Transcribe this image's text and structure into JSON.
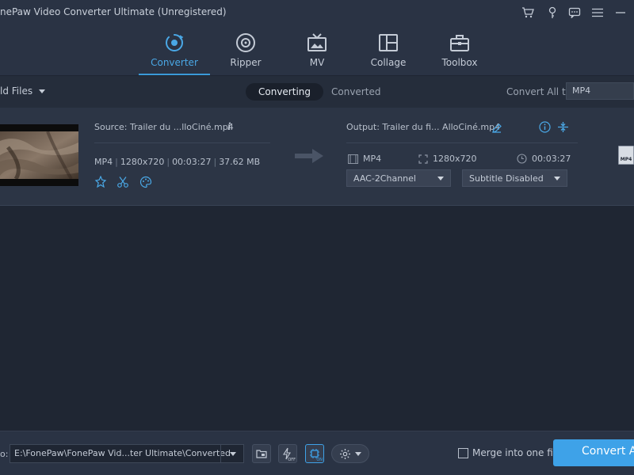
{
  "app": {
    "title": "nePaw Video Converter Ultimate (Unregistered)"
  },
  "titlebar_icons": [
    "cart-icon",
    "key-icon",
    "chat-icon",
    "menu-icon",
    "minimize-icon"
  ],
  "nav": {
    "tabs": [
      {
        "label": "Converter",
        "icon": "converter-icon",
        "active": true
      },
      {
        "label": "Ripper",
        "icon": "ripper-icon",
        "active": false
      },
      {
        "label": "MV",
        "icon": "mv-icon",
        "active": false
      },
      {
        "label": "Collage",
        "icon": "collage-icon",
        "active": false
      },
      {
        "label": "Toolbox",
        "icon": "toolbox-icon",
        "active": false
      }
    ]
  },
  "toolbar": {
    "add_files": "ld Files",
    "segments": [
      "Converting",
      "Converted"
    ],
    "active_segment": "Converting",
    "convert_all_label": "Convert All to:",
    "convert_all_value": "MP4"
  },
  "file": {
    "source_name": "Source: Trailer du ...lloCiné.mp4",
    "info_label": "i",
    "src_meta": {
      "format": "MP4",
      "resolution": "1280x720",
      "duration": "00:03:27",
      "size": "37.62 MB"
    },
    "output_name": "Output: Trailer du fi... AlloCiné.mp4",
    "out_meta": {
      "format": "MP4",
      "resolution": "1280x720",
      "duration": "00:03:27"
    },
    "audio_track": "AAC-2Channel",
    "subtitle": "Subtitle Disabled",
    "format_badge": "MP4"
  },
  "bottom": {
    "save_label": "o:",
    "save_path": "E:\\FonePaw\\FonePaw Vid...ter Ultimate\\Converted",
    "hw_off_label": "OFF",
    "gpu_on_label": "ON",
    "merge_label": "Merge into one file",
    "merge_checked": false,
    "convert_button": "Convert All"
  },
  "colors": {
    "accent": "#3ea2e8",
    "active_tab": "#4aa8e6",
    "background": "#1f2633",
    "panel": "#2a3344"
  }
}
